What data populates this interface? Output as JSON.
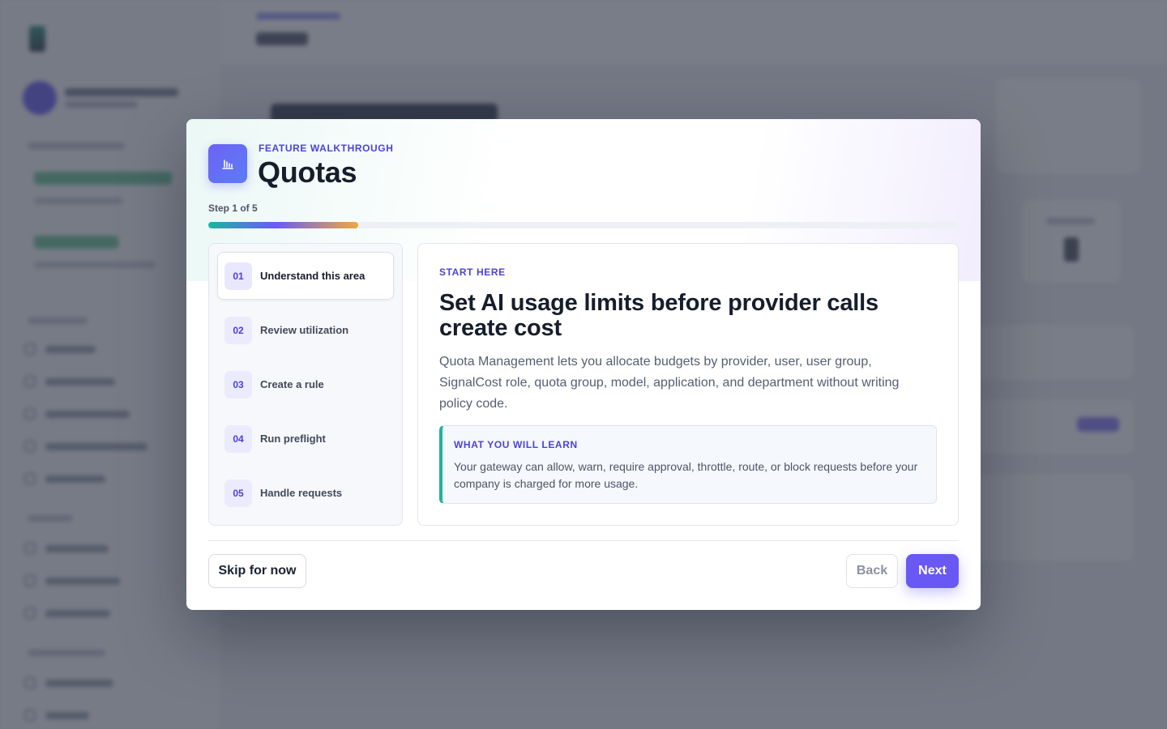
{
  "modal": {
    "eyebrow": "FEATURE WALKTHROUGH",
    "title": "Quotas",
    "icon": "bar-chart-icon",
    "step_counter": "Step 1 of 5",
    "progress": 0.2
  },
  "steps": [
    {
      "number": "01",
      "label": "Understand this area",
      "active": true
    },
    {
      "number": "02",
      "label": "Review utilization",
      "active": false
    },
    {
      "number": "03",
      "label": "Create a rule",
      "active": false
    },
    {
      "number": "04",
      "label": "Run preflight",
      "active": false
    },
    {
      "number": "05",
      "label": "Handle requests",
      "active": false
    }
  ],
  "content": {
    "eyebrow": "START HERE",
    "title": "Set AI usage limits before provider calls create cost",
    "body": "Quota Management lets you allocate budgets by provider, user, user group, SignalCost role, quota group, model, application, and department without writing policy code.",
    "learn_title": "WHAT YOU WILL LEARN",
    "learn_body": "Your gateway can allow, warn, require approval, throttle, route, or block requests before your company is charged for more usage."
  },
  "footer": {
    "skip_label": "Skip for now",
    "back_label": "Back",
    "next_label": "Next"
  },
  "colors": {
    "accent": "#6a58f4",
    "accent_text": "#4b43d6",
    "teal": "#1eb4a0",
    "progress_end": "#f0a840"
  }
}
